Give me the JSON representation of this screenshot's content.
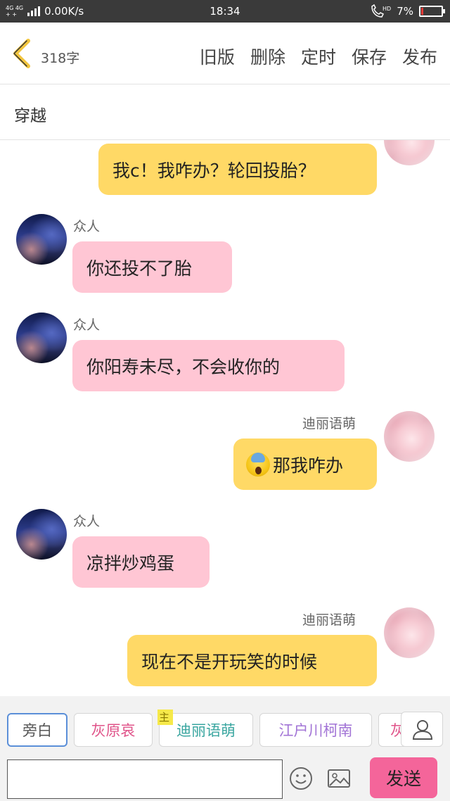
{
  "status_bar": {
    "network": "4G 4G",
    "network_sub": "+ +",
    "speed": "0.00K/s",
    "time": "18:34",
    "call_hd": "HD",
    "battery_percent": "7%",
    "battery_level": 0.07,
    "battery_color": "#e53935"
  },
  "header": {
    "title": "318字",
    "actions": [
      "旧版",
      "删除",
      "定时",
      "保存",
      "发布"
    ],
    "back_icon": "chevron-left-icon",
    "accent": "#f2c53d"
  },
  "subtitle": "穿越",
  "messages": [
    {
      "side": "right",
      "sender": "",
      "text": "我c！我咋办？轮回投胎？",
      "bubble_color": "#ffd966"
    },
    {
      "side": "left",
      "sender": "众人",
      "text": "你还投不了胎",
      "bubble_color": "#ffc6d4"
    },
    {
      "side": "left",
      "sender": "众人",
      "text": "你阳寿未尽，不会收你的",
      "bubble_color": "#ffc6d4"
    },
    {
      "side": "right",
      "sender": "迪丽语萌",
      "text": "那我咋办",
      "emoji": "scream-emoji",
      "bubble_color": "#ffd966"
    },
    {
      "side": "left",
      "sender": "众人",
      "text": "凉拌炒鸡蛋",
      "bubble_color": "#ffc6d4"
    },
    {
      "side": "right",
      "sender": "迪丽语萌",
      "text": "现在不是开玩笑的时候",
      "bubble_color": "#ffd966"
    }
  ],
  "roles": [
    {
      "label": "旁白",
      "color": "#555555",
      "selected": true
    },
    {
      "label": "灰原哀",
      "color": "#e0548a",
      "selected": false
    },
    {
      "label": "迪丽语萌",
      "color": "#3aa6a0",
      "selected": false,
      "badge": "主"
    },
    {
      "label": "江户川柯南",
      "color": "#a274d6",
      "selected": false
    },
    {
      "label": "灰",
      "color": "#e0548a",
      "selected": false
    }
  ],
  "input": {
    "placeholder": "",
    "value": ""
  },
  "send_label": "发送",
  "icons": {
    "emoji": "smiley-icon",
    "image": "image-icon",
    "profile": "person-icon"
  }
}
